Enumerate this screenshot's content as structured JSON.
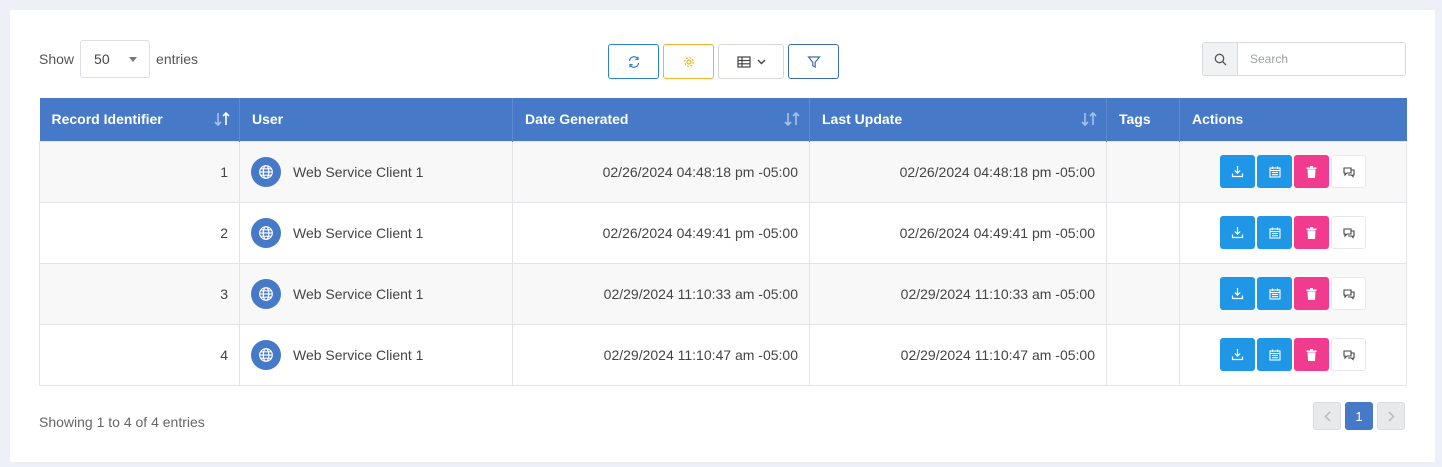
{
  "length_menu": {
    "show_label": "Show",
    "value": "50",
    "entries_label": "entries"
  },
  "toolbar": {
    "buttons": [
      {
        "name": "refresh",
        "icon": "refresh-icon",
        "color": "#2b84c7"
      },
      {
        "name": "settings",
        "icon": "gear-icon",
        "color": "#f2b32a"
      },
      {
        "name": "columns",
        "icon": "table-icon",
        "color": "#444444"
      },
      {
        "name": "filter",
        "icon": "filter-icon",
        "color": "#3a6ea9"
      }
    ]
  },
  "search": {
    "placeholder": "Search",
    "value": ""
  },
  "table": {
    "header_color": "#4679c7",
    "columns": [
      "Record Identifier",
      "User",
      "Date Generated",
      "Last Update",
      "Tags",
      "Actions"
    ],
    "rows": [
      {
        "id": "1",
        "user": "Web Service Client 1",
        "date_generated": "02/26/2024 04:48:18 pm -05:00",
        "last_update": "02/26/2024 04:48:18 pm -05:00",
        "tags": ""
      },
      {
        "id": "2",
        "user": "Web Service Client 1",
        "date_generated": "02/26/2024 04:49:41 pm -05:00",
        "last_update": "02/26/2024 04:49:41 pm -05:00",
        "tags": ""
      },
      {
        "id": "3",
        "user": "Web Service Client 1",
        "date_generated": "02/29/2024 11:10:33 am -05:00",
        "last_update": "02/29/2024 11:10:33 am -05:00",
        "tags": ""
      },
      {
        "id": "4",
        "user": "Web Service Client 1",
        "date_generated": "02/29/2024 11:10:47 am -05:00",
        "last_update": "02/29/2024 11:10:47 am -05:00",
        "tags": ""
      }
    ],
    "row_action_icons": [
      "download-icon",
      "calendar-icon",
      "trash-icon",
      "comment-icon"
    ],
    "action_colors": {
      "blue": "#2096e6",
      "pink": "#f13b8e"
    }
  },
  "footer": {
    "info": "Showing 1 to 4 of 4 entries",
    "pagination": {
      "current_page": "1"
    }
  }
}
